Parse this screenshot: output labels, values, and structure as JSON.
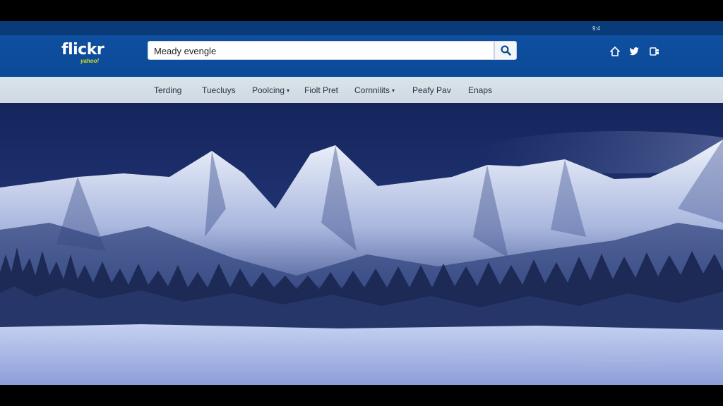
{
  "status": {
    "text": "9:4"
  },
  "header": {
    "logo": "flickr",
    "logo_tag": "yahoo!",
    "search": {
      "value": "Meady evengle"
    },
    "icons": [
      "home-icon",
      "twitter-icon",
      "apps-icon"
    ]
  },
  "nav": {
    "items": [
      {
        "label": "Terding"
      },
      {
        "label": "Tuecluys"
      },
      {
        "label": "Poolcing"
      },
      {
        "label": "Fiolt Pret"
      },
      {
        "label": "Cornnilits"
      },
      {
        "label": "Peafy Pav"
      },
      {
        "label": "Enaps"
      }
    ]
  },
  "hero": {
    "image": "snowy-mountains-night-photo"
  },
  "colors": {
    "header": "#0c4a98",
    "navbar": "#d3dce5",
    "sky": "#1c2f6b",
    "snow": "#e8eefc"
  }
}
